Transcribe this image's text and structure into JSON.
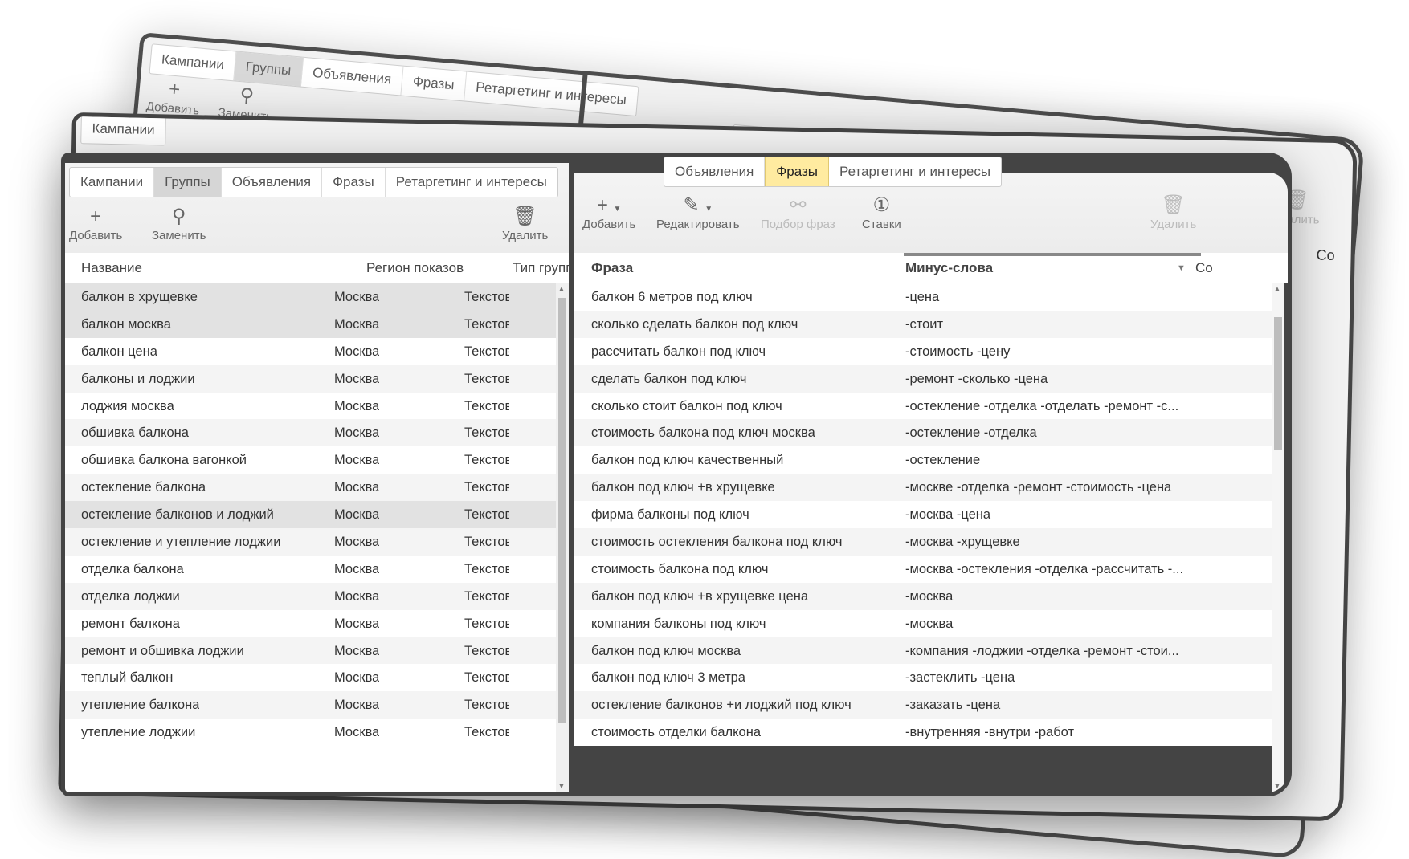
{
  "left": {
    "tabs": [
      "Кампании",
      "Группы",
      "Объявления",
      "Фразы",
      "Ретаргетинг и интересы"
    ],
    "toolbar": {
      "add": "Добавить",
      "replace": "Заменить",
      "delete": "Удалить"
    },
    "columns": {
      "name": "Название",
      "region": "Регион показов",
      "type": "Тип группы"
    },
    "rows": [
      {
        "name": "балкон в хрущевке",
        "region": "Москва",
        "type": "Текстово",
        "selected": true
      },
      {
        "name": "балкон москва",
        "region": "Москва",
        "type": "Текстово",
        "selected": true
      },
      {
        "name": "балкон цена",
        "region": "Москва",
        "type": "Текстово"
      },
      {
        "name": "балконы и лоджии",
        "region": "Москва",
        "type": "Текстово"
      },
      {
        "name": "лоджия москва",
        "region": "Москва",
        "type": "Текстово"
      },
      {
        "name": "обшивка балкона",
        "region": "Москва",
        "type": "Текстово"
      },
      {
        "name": "обшивка балкона вагонкой",
        "region": "Москва",
        "type": "Текстово"
      },
      {
        "name": "остекление балкона",
        "region": "Москва",
        "type": "Текстово"
      },
      {
        "name": "остекление балконов и лоджий",
        "region": "Москва",
        "type": "Текстово",
        "selected": true
      },
      {
        "name": "остекление и утепление лоджии",
        "region": "Москва",
        "type": "Текстово"
      },
      {
        "name": "отделка балкона",
        "region": "Москва",
        "type": "Текстово"
      },
      {
        "name": "отделка лоджии",
        "region": "Москва",
        "type": "Текстово"
      },
      {
        "name": "ремонт балкона",
        "region": "Москва",
        "type": "Текстово"
      },
      {
        "name": "ремонт и обшивка лоджии",
        "region": "Москва",
        "type": "Текстово"
      },
      {
        "name": "теплый балкон",
        "region": "Москва",
        "type": "Текстово"
      },
      {
        "name": "утепление балкона",
        "region": "Москва",
        "type": "Текстово"
      },
      {
        "name": "утепление лоджии",
        "region": "Москва",
        "type": "Текстово"
      }
    ]
  },
  "right": {
    "tabs": [
      "Объявления",
      "Фразы",
      "Ретаргетинг и интересы"
    ],
    "toolbar": {
      "add": "Добавить",
      "edit": "Редактировать",
      "pick": "Подбор фраз",
      "bids": "Ставки",
      "delete": "Удалить"
    },
    "columns": {
      "phrase": "Фраза",
      "minus": "Минус-слова",
      "next": "Co"
    },
    "rows": [
      {
        "phrase": "балкон 6 метров под ключ",
        "minus": "-цена"
      },
      {
        "phrase": "сколько сделать балкон под ключ",
        "minus": "-стоит"
      },
      {
        "phrase": "рассчитать балкон под ключ",
        "minus": "-стоимость -цену"
      },
      {
        "phrase": "сделать балкон под ключ",
        "minus": "-ремонт -сколько -цена"
      },
      {
        "phrase": "сколько стоит балкон под ключ",
        "minus": "-остекление -отделка -отделать -ремонт -с..."
      },
      {
        "phrase": "стоимость балкона под ключ москва",
        "minus": "-остекление -отделка"
      },
      {
        "phrase": "балкон под ключ качественный",
        "minus": "-остекление"
      },
      {
        "phrase": "балкон под ключ +в хрущевке",
        "minus": "-москве -отделка -ремонт -стоимость -цена"
      },
      {
        "phrase": "фирма балконы под ключ",
        "minus": "-москва -цена"
      },
      {
        "phrase": "стоимость остекления балкона под ключ",
        "minus": "-москва -хрущевке"
      },
      {
        "phrase": "стоимость балкона под ключ",
        "minus": "-москва -остекления -отделка -рассчитать -..."
      },
      {
        "phrase": "балкон под ключ +в хрущевке цена",
        "minus": "-москва"
      },
      {
        "phrase": "компания балконы под ключ",
        "minus": "-москва"
      },
      {
        "phrase": "балкон под ключ москва",
        "minus": "-компания -лоджии -отделка -ремонт -стои..."
      },
      {
        "phrase": "балкон под ключ 3 метра",
        "minus": "-застеклить -цена"
      },
      {
        "phrase": "остекление балконов +и лоджий под ключ",
        "minus": "-заказать -цена"
      },
      {
        "phrase": "стоимость отделки балкона",
        "minus": "-внутренняя -внутри -работ"
      }
    ]
  },
  "colors": {
    "dark": "#444444",
    "active_yellow": "#ffeba0",
    "active_gray": "#d6d6d6"
  }
}
